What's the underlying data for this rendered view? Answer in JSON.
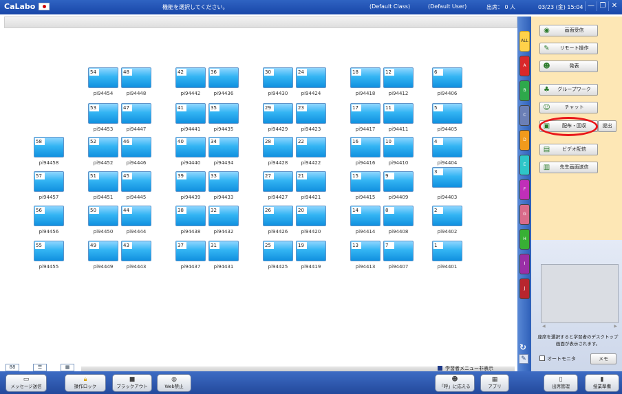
{
  "titlebar": {
    "app_name": "CaLabo",
    "instruction": "機能を選択してください。",
    "class_name": "(Default Class)",
    "user_name": "(Default User)",
    "attendance": "出席： 0 人",
    "datetime": "03/23 (金) 15:04",
    "min_glyph": "—",
    "restore_glyph": "❐",
    "close_glyph": "✕"
  },
  "seats": [
    {
      "num": "54",
      "label": "pi94454"
    },
    {
      "num": "48",
      "label": "pi94448"
    },
    {
      "num": "42",
      "label": "pi94442"
    },
    {
      "num": "36",
      "label": "pi94436"
    },
    {
      "num": "30",
      "label": "pi94430"
    },
    {
      "num": "24",
      "label": "pi94424"
    },
    {
      "num": "18",
      "label": "pi94418"
    },
    {
      "num": "12",
      "label": "pi94412"
    },
    {
      "num": "6",
      "label": "pi94406"
    },
    {
      "num": "53",
      "label": "pi94453"
    },
    {
      "num": "47",
      "label": "pi94447"
    },
    {
      "num": "41",
      "label": "pi94441"
    },
    {
      "num": "35",
      "label": "pi94435"
    },
    {
      "num": "29",
      "label": "pi94429"
    },
    {
      "num": "23",
      "label": "pi94423"
    },
    {
      "num": "17",
      "label": "pi94417"
    },
    {
      "num": "11",
      "label": "pi94411"
    },
    {
      "num": "5",
      "label": "pi94405"
    },
    {
      "num": "58",
      "label": "pi94458"
    },
    {
      "num": "52",
      "label": "pi94452"
    },
    {
      "num": "46",
      "label": "pi94446"
    },
    {
      "num": "40",
      "label": "pi94440"
    },
    {
      "num": "34",
      "label": "pi94434"
    },
    {
      "num": "28",
      "label": "pi94428"
    },
    {
      "num": "22",
      "label": "pi94422"
    },
    {
      "num": "16",
      "label": "pi94416"
    },
    {
      "num": "10",
      "label": "pi94410"
    },
    {
      "num": "4",
      "label": "pi94404"
    },
    {
      "num": "57",
      "label": "pi94457"
    },
    {
      "num": "51",
      "label": "pi94451"
    },
    {
      "num": "45",
      "label": "pi94445"
    },
    {
      "num": "39",
      "label": "pi94439"
    },
    {
      "num": "33",
      "label": "pi94433"
    },
    {
      "num": "27",
      "label": "pi94427"
    },
    {
      "num": "21",
      "label": "pi94421"
    },
    {
      "num": "15",
      "label": "pi94415"
    },
    {
      "num": "9",
      "label": "pi94409"
    },
    {
      "num": "3",
      "label": "pi94403"
    },
    {
      "num": "56",
      "label": "pi94456"
    },
    {
      "num": "50",
      "label": "pi94450"
    },
    {
      "num": "44",
      "label": "pi94444"
    },
    {
      "num": "38",
      "label": "pi94438"
    },
    {
      "num": "32",
      "label": "pi94432"
    },
    {
      "num": "26",
      "label": "pi94426"
    },
    {
      "num": "20",
      "label": "pi94420"
    },
    {
      "num": "14",
      "label": "pi94414"
    },
    {
      "num": "8",
      "label": "pi94408"
    },
    {
      "num": "2",
      "label": "pi94402"
    },
    {
      "num": "55",
      "label": "pi94455"
    },
    {
      "num": "49",
      "label": "pi94449"
    },
    {
      "num": "43",
      "label": "pi94443"
    },
    {
      "num": "37",
      "label": "pi94437"
    },
    {
      "num": "31",
      "label": "pi94431"
    },
    {
      "num": "25",
      "label": "pi94425"
    },
    {
      "num": "19",
      "label": "pi94419"
    },
    {
      "num": "13",
      "label": "pi94413"
    },
    {
      "num": "7",
      "label": "pi94407"
    },
    {
      "num": "1",
      "label": "pi94401"
    }
  ],
  "view_tabs": [
    "88",
    "☰",
    "▦"
  ],
  "hide_menu_label": "学習者メニュー非表示",
  "groups": [
    "ALL",
    "A",
    "B",
    "C",
    "D",
    "E",
    "F",
    "G",
    "H",
    "I",
    "J"
  ],
  "group_colors": [
    "#ffd24a",
    "#d9282a",
    "#2ea84b",
    "#6b7fb6",
    "#f29a1c",
    "#2ec6c8",
    "#c12fb8",
    "#d96b8a",
    "#38b034",
    "#9a2fa6",
    "#b8262e"
  ],
  "functions": {
    "screen_receive": {
      "label": "画面受信",
      "icon": "receive-icon"
    },
    "remote_control": {
      "label": "リモート操作",
      "icon": "remote-icon"
    },
    "presentation": {
      "label": "発表",
      "icon": "present-icon"
    },
    "group_work": {
      "label": "グループワーク",
      "icon": "group-icon"
    },
    "chat": {
      "label": "チャット",
      "icon": "chat-icon"
    },
    "distribute_collect": {
      "label": "配布・回収",
      "icon": "distribute-icon"
    },
    "submit": {
      "label": "提出"
    },
    "video_delivery": {
      "label": "ビデオ配信",
      "icon": "video-icon"
    },
    "teacher_screen": {
      "label": "先生画面送信",
      "icon": "teacher-screen-icon"
    }
  },
  "preview": {
    "hint_line1": "座席を選択すると学習者のデスクトップ",
    "hint_line2": "画面が表示されます。",
    "auto_monitor": "オートモニタ",
    "memo": "メモ"
  },
  "bottom_buttons": {
    "message": "メッセージ送信",
    "lock": "操作ロック",
    "blackout": "ブラックアウト",
    "web_block": "Web禁止",
    "respond": "「呼」に応える",
    "app": "アプリ",
    "attendance_mgmt": "出席管理",
    "class_prep": "授業準備"
  },
  "colors": {
    "accent": "#1846a8",
    "highlight": "#e8161a",
    "panel": "#fde7b5"
  }
}
